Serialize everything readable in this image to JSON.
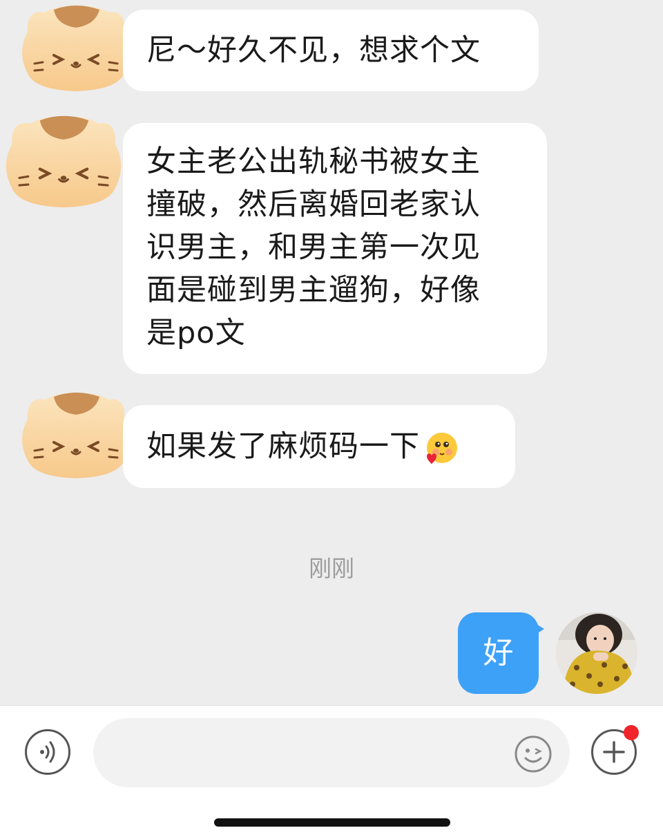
{
  "messages": [
    {
      "sender": "other",
      "text": "尼～好久不见，想求个文"
    },
    {
      "sender": "other",
      "lines": [
        "女主老公出轨秘书被女主",
        "撞破，然后离婚回老家认",
        "识男主，和男主第一次见",
        "面是碰到男主遛狗，好像",
        "是po文"
      ]
    },
    {
      "sender": "other",
      "text": "如果发了麻烦码一下",
      "emoji": "blushing-heart-emoji"
    }
  ],
  "timestamp": "刚刚",
  "reply": {
    "sender": "me",
    "text": "好"
  },
  "input_bar": {
    "placeholder": "",
    "voice_icon": "voice-icon",
    "emoji_icon": "smiley-icon",
    "plus_icon": "plus-icon",
    "has_notification": true
  },
  "colors": {
    "background": "#ededed",
    "incoming_bubble": "#ffffff",
    "outgoing_bubble": "#3ea1f8",
    "notification_dot": "#f0242a",
    "timestamp_text": "#9c9c9c"
  }
}
